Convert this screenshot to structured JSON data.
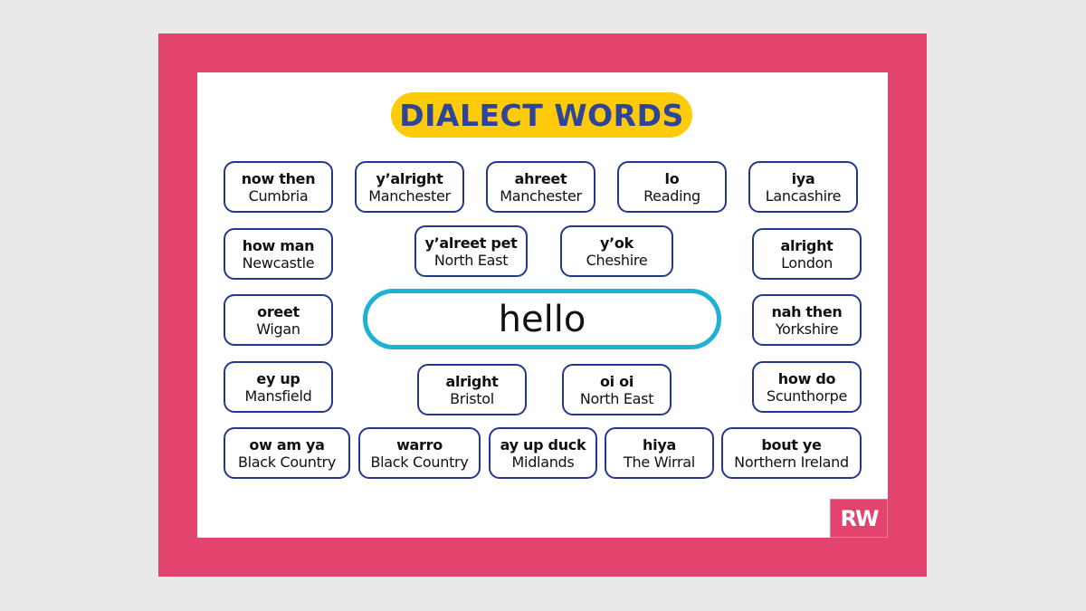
{
  "title": "DIALECT WORDS",
  "center_word": "hello",
  "logo_text": "RW",
  "colors": {
    "frame": "#e2446d",
    "title_bg": "#fdcb0a",
    "title_text": "#2d4499",
    "card_border": "#23378c",
    "center_border": "#1db2d4"
  },
  "cards": [
    {
      "word": "now then",
      "place": "Cumbria"
    },
    {
      "word": "y’alright",
      "place": "Manchester"
    },
    {
      "word": "ahreet",
      "place": "Manchester"
    },
    {
      "word": "lo",
      "place": "Reading"
    },
    {
      "word": "iya",
      "place": "Lancashire"
    },
    {
      "word": "how man",
      "place": "Newcastle"
    },
    {
      "word": "y’alreet pet",
      "place": "North East"
    },
    {
      "word": "y’ok",
      "place": "Cheshire"
    },
    {
      "word": "alright",
      "place": "London"
    },
    {
      "word": "oreet",
      "place": "Wigan"
    },
    {
      "word": "nah then",
      "place": "Yorkshire"
    },
    {
      "word": "ey up",
      "place": "Mansfield"
    },
    {
      "word": "alright",
      "place": "Bristol"
    },
    {
      "word": "oi oi",
      "place": "North East"
    },
    {
      "word": "how do",
      "place": "Scunthorpe"
    },
    {
      "word": "ow am ya",
      "place": "Black Country"
    },
    {
      "word": "warro",
      "place": "Black Country"
    },
    {
      "word": "ay up duck",
      "place": "Midlands"
    },
    {
      "word": "hiya",
      "place": "The Wirral"
    },
    {
      "word": "bout ye",
      "place": "Northern Ireland"
    }
  ]
}
